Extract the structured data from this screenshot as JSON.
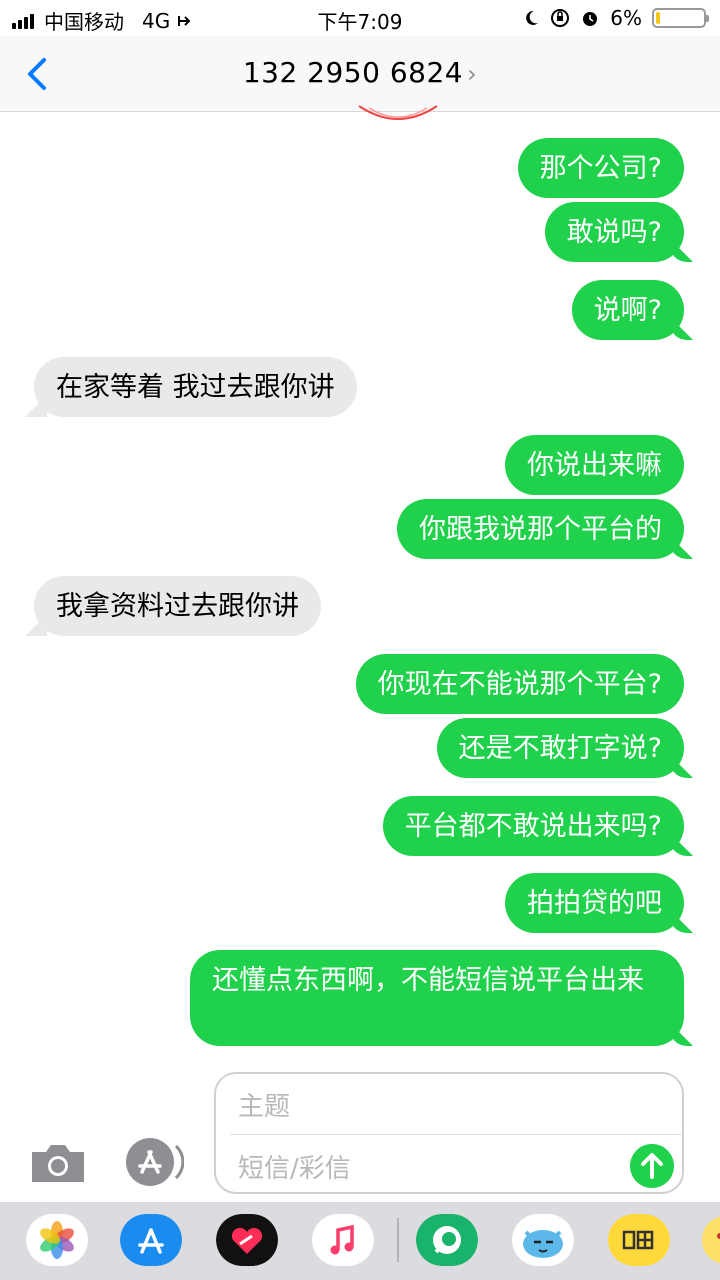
{
  "status_bar": {
    "carrier": "中国移动",
    "network": "4G",
    "time": "下午7:09",
    "battery_percent": "6%",
    "battery_level": 0.06
  },
  "nav": {
    "title": "132 2950 6824",
    "chevron": "›"
  },
  "messages": [
    {
      "dir": "out",
      "text": "那个公司?"
    },
    {
      "dir": "out",
      "text": "敢说吗?"
    },
    {
      "dir": "out",
      "text": "说啊?"
    },
    {
      "dir": "in",
      "text": "在家等着  我过去跟你讲"
    },
    {
      "dir": "out",
      "text": "你说出来嘛"
    },
    {
      "dir": "out",
      "text": "你跟我说那个平台的"
    },
    {
      "dir": "in",
      "text": "我拿资料过去跟你讲"
    },
    {
      "dir": "out",
      "text": "你现在不能说那个平台?"
    },
    {
      "dir": "out",
      "text": "还是不敢打字说?"
    },
    {
      "dir": "out",
      "text": "平台都不敢说出来吗?"
    },
    {
      "dir": "out",
      "text": "拍拍贷的吧"
    },
    {
      "dir": "out",
      "text": "还懂点东西啊，不能短信说平台出来"
    }
  ],
  "compose": {
    "subject_placeholder": "主题",
    "message_placeholder": "短信/彩信"
  },
  "drawer_apps": [
    "photos-app-icon",
    "app-store-app-icon",
    "digital-touch-app-icon",
    "music-app-icon",
    "green-chat-app-icon",
    "blue-monster-app-icon",
    "xianyu-app-icon",
    "emoji-app-icon"
  ],
  "colors": {
    "outgoing": "#1fd14b",
    "incoming": "#e9e9eb",
    "accent": "#007aff"
  }
}
